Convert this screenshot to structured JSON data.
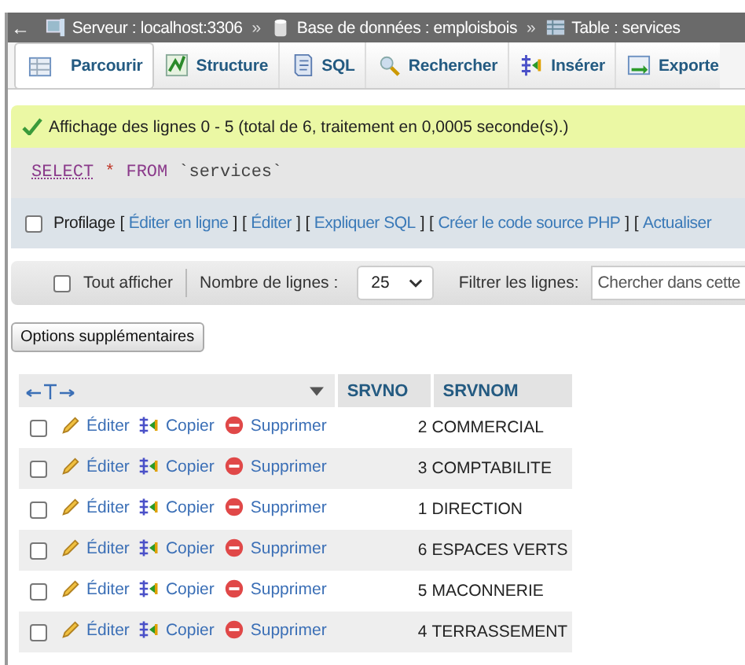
{
  "breadcrumb": {
    "back": "←",
    "items": [
      {
        "kind": "server",
        "label": "Serveur : localhost:3306"
      },
      {
        "kind": "separator",
        "label": "»"
      },
      {
        "kind": "database",
        "label": "Base de données : emploisbois"
      },
      {
        "kind": "separator",
        "label": "»"
      },
      {
        "kind": "table",
        "label": "Table : services"
      }
    ]
  },
  "tabs": [
    {
      "kind": "browse",
      "label": "Parcourir",
      "selected": true
    },
    {
      "kind": "structure",
      "label": "Structure",
      "selected": false
    },
    {
      "kind": "sql",
      "label": "SQL",
      "selected": false
    },
    {
      "kind": "search",
      "label": "Rechercher",
      "selected": false
    },
    {
      "kind": "insert",
      "label": "Insérer",
      "selected": false
    },
    {
      "kind": "export",
      "label": "Exporte",
      "selected": false
    }
  ],
  "message": "Affichage des lignes 0 - 5 (total de 6, traitement en 0,0005 seconde(s).)",
  "sql_query": [
    {
      "kind": "keyword_link",
      "text": "SELECT"
    },
    {
      "kind": "operator",
      "text": "*"
    },
    {
      "kind": "keyword",
      "text": "FROM"
    },
    {
      "kind": "identifier",
      "text": "`services`"
    }
  ],
  "profiling": {
    "label": "Profilage",
    "checked": false,
    "items": [
      {
        "kind": "bracket",
        "text": "["
      },
      {
        "kind": "link",
        "text": "Éditer en ligne"
      },
      {
        "kind": "bracket",
        "text": "]"
      },
      {
        "kind": "bracket",
        "text": "["
      },
      {
        "kind": "link",
        "text": "Éditer"
      },
      {
        "kind": "bracket",
        "text": "]"
      },
      {
        "kind": "bracket",
        "text": "["
      },
      {
        "kind": "link",
        "text": "Expliquer SQL"
      },
      {
        "kind": "bracket",
        "text": "]"
      },
      {
        "kind": "bracket",
        "text": "["
      },
      {
        "kind": "link",
        "text": "Créer le code source PHP"
      },
      {
        "kind": "bracket",
        "text": "]"
      },
      {
        "kind": "bracket",
        "text": "["
      },
      {
        "kind": "link",
        "text": "Actualiser"
      }
    ]
  },
  "navigation": {
    "show_all": {
      "label": "Tout afficher",
      "checked": false
    },
    "rows_label": "Nombre de lignes :",
    "rows_value": "25",
    "filter_label": "Filtrer les lignes:",
    "filter_placeholder": "Chercher dans cette"
  },
  "options_button": "Options supplémentaires",
  "table": {
    "columns": [
      "SRVNO",
      "SRVNOM"
    ],
    "rows": [
      {
        "checked": false,
        "actions": [
          {
            "kind": "edit",
            "label": "Éditer"
          },
          {
            "kind": "copy",
            "label": "Copier"
          },
          {
            "kind": "delete",
            "label": "Supprimer"
          }
        ],
        "cells": [
          "2",
          "COMMERCIAL"
        ]
      },
      {
        "checked": false,
        "actions": [
          {
            "kind": "edit",
            "label": "Éditer"
          },
          {
            "kind": "copy",
            "label": "Copier"
          },
          {
            "kind": "delete",
            "label": "Supprimer"
          }
        ],
        "cells": [
          "3",
          "COMPTABILITE"
        ]
      },
      {
        "checked": false,
        "actions": [
          {
            "kind": "edit",
            "label": "Éditer"
          },
          {
            "kind": "copy",
            "label": "Copier"
          },
          {
            "kind": "delete",
            "label": "Supprimer"
          }
        ],
        "cells": [
          "1",
          "DIRECTION"
        ]
      },
      {
        "checked": false,
        "actions": [
          {
            "kind": "edit",
            "label": "Éditer"
          },
          {
            "kind": "copy",
            "label": "Copier"
          },
          {
            "kind": "delete",
            "label": "Supprimer"
          }
        ],
        "cells": [
          "6",
          "ESPACES VERTS"
        ]
      },
      {
        "checked": false,
        "actions": [
          {
            "kind": "edit",
            "label": "Éditer"
          },
          {
            "kind": "copy",
            "label": "Copier"
          },
          {
            "kind": "delete",
            "label": "Supprimer"
          }
        ],
        "cells": [
          "5",
          "MACONNERIE"
        ]
      },
      {
        "checked": false,
        "actions": [
          {
            "kind": "edit",
            "label": "Éditer"
          },
          {
            "kind": "copy",
            "label": "Copier"
          },
          {
            "kind": "delete",
            "label": "Supprimer"
          }
        ],
        "cells": [
          "4",
          "TERRASSEMENT"
        ]
      }
    ]
  }
}
